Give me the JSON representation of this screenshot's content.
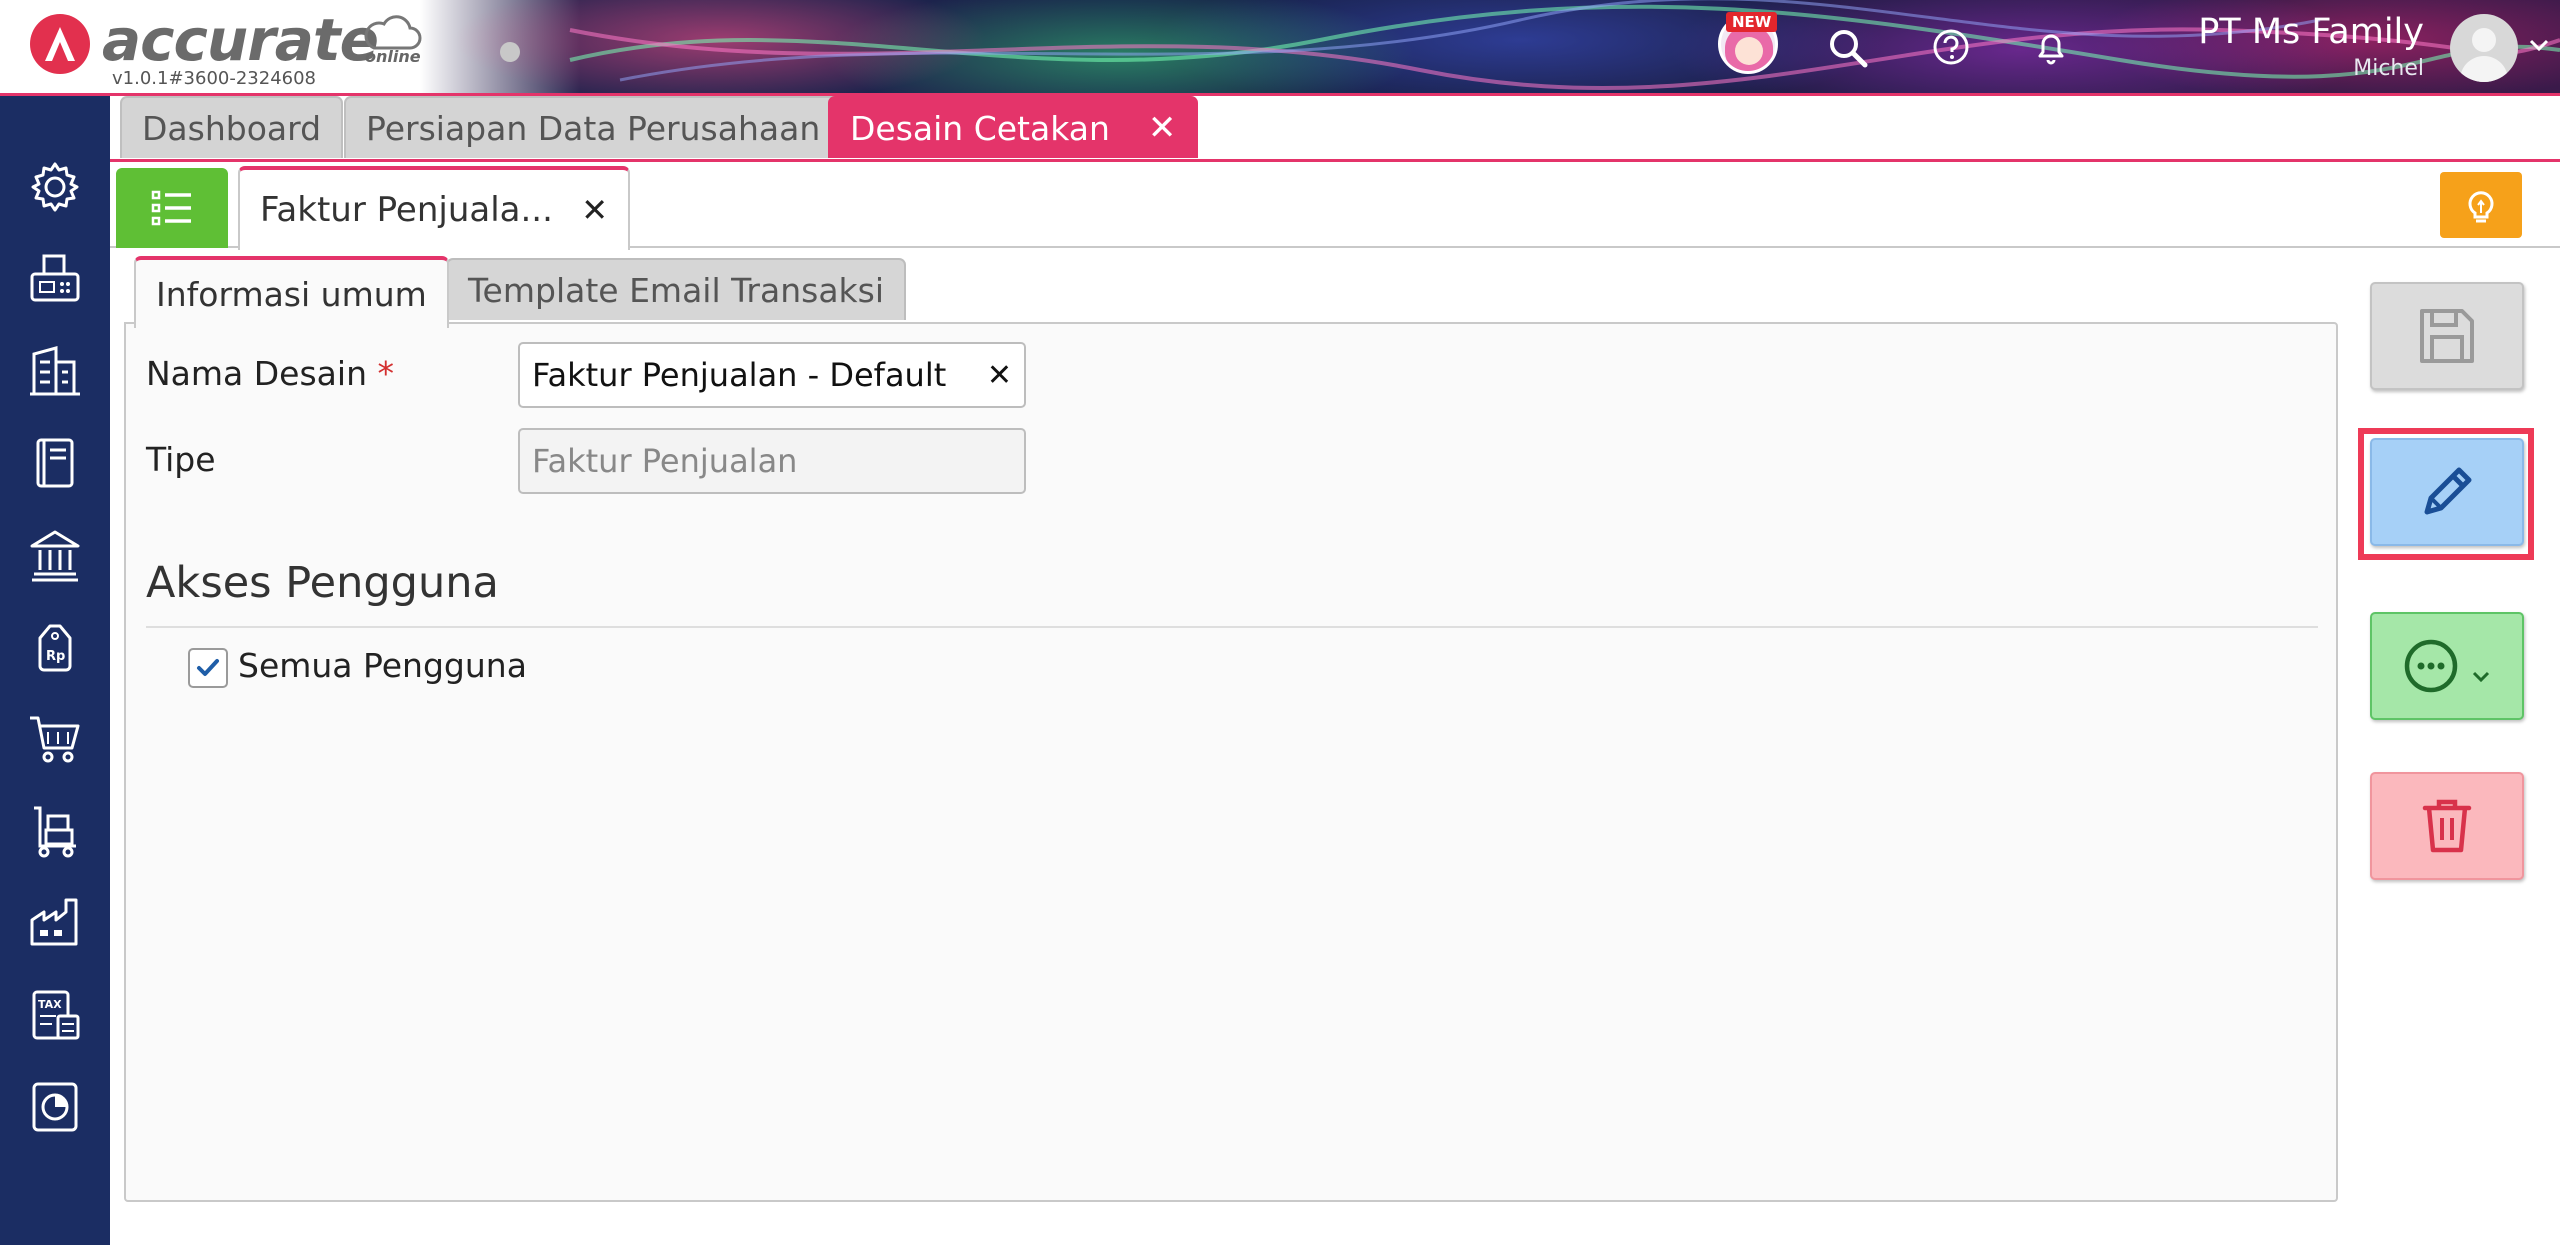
{
  "header": {
    "brand_name": "accurate",
    "brand_sub": "online",
    "version": "v1.0.1#3600-2324608",
    "new_badge": "NEW",
    "company_name": "PT Ms Family",
    "user_name": "Michel",
    "icons": [
      "search-icon",
      "help-icon",
      "bell-icon",
      "chevron-down-icon"
    ]
  },
  "sidebar": {
    "items": [
      {
        "icon": "gear-icon"
      },
      {
        "icon": "fax-icon"
      },
      {
        "icon": "building-icon"
      },
      {
        "icon": "ledger-book-icon"
      },
      {
        "icon": "bank-icon"
      },
      {
        "icon": "price-tag-icon"
      },
      {
        "icon": "shopping-cart-icon"
      },
      {
        "icon": "hand-truck-icon"
      },
      {
        "icon": "factory-icon"
      },
      {
        "icon": "tax-icon"
      },
      {
        "icon": "pie-chart-icon"
      }
    ]
  },
  "module_tabs": {
    "tabs": [
      {
        "label": "Dashboard",
        "active": false
      },
      {
        "label": "Persiapan Data Perusahaan",
        "active": false
      },
      {
        "label": "Desain Cetakan",
        "active": true
      }
    ],
    "count": "3"
  },
  "doc_tabs": {
    "current_label": "Faktur Penjuala..."
  },
  "form": {
    "tabs": [
      "Informasi umum",
      "Template Email Transaksi"
    ],
    "name_label": "Nama Desain",
    "required_mark": "*",
    "name_value": "Faktur Penjualan - Default",
    "type_label": "Tipe",
    "type_value": "Faktur Penjualan",
    "section_title": "Akses Pengguna",
    "checkbox_label": "Semua Pengguna",
    "checkbox_checked": true
  },
  "actions": {
    "icons": [
      "floppy-disk-icon",
      "pencil-icon",
      "more-options-icon",
      "trash-icon"
    ]
  },
  "colors": {
    "accent": "#e4346a",
    "sidebar": "#1b2d63",
    "list_button": "#5fbf35",
    "tips_button": "#f6a11a",
    "edit_button": "#a6d0f7",
    "more_button": "#a5e7a8",
    "delete_button": "#fbb8bd",
    "highlight": "#ee3a57"
  }
}
